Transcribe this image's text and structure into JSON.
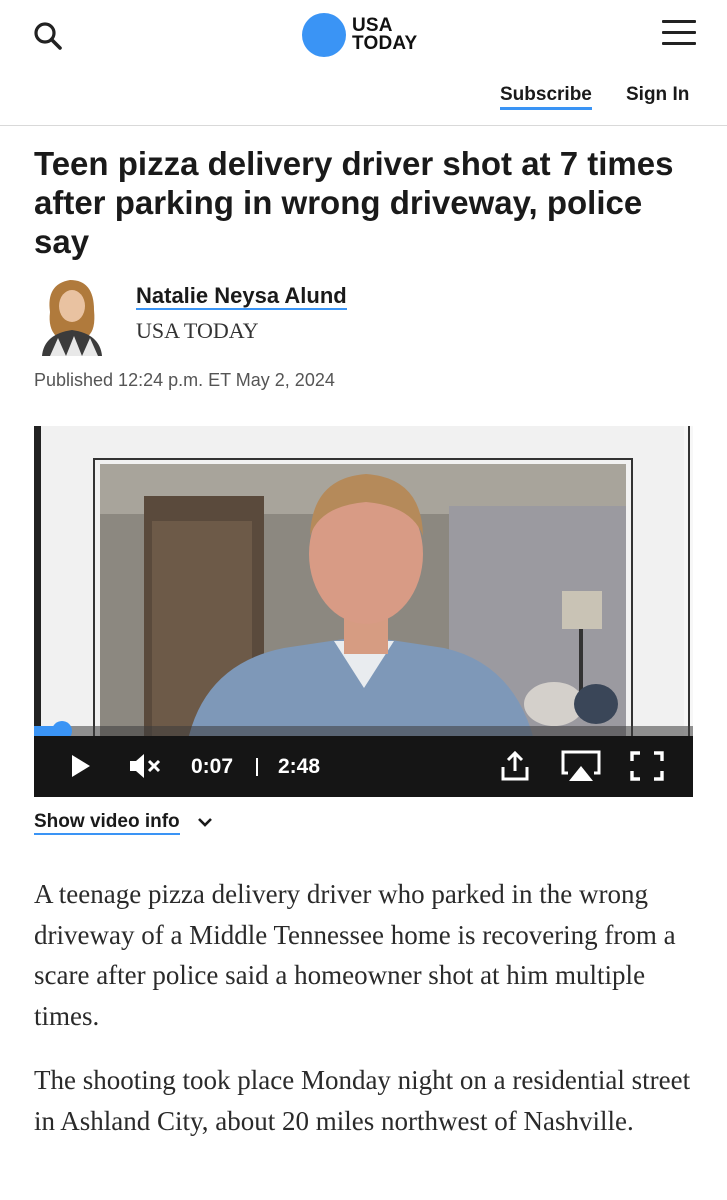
{
  "header": {
    "logo_line1": "USA",
    "logo_line2": "TODAY",
    "subscribe_label": "Subscribe",
    "signin_label": "Sign In",
    "search_icon": "search-icon",
    "menu_icon": "hamburger-menu-icon",
    "brand_color": "#3a94f5"
  },
  "article": {
    "headline": "Teen pizza delivery driver shot at 7 times after parking in wrong driveway, police say",
    "author_name": "Natalie Neysa Alund",
    "author_org": "USA TODAY",
    "published": "Published 12:24 p.m. ET May 2, 2024",
    "paragraphs": [
      "A teenage pizza delivery driver who parked in the wrong driveway of a Middle Tennessee home is recovering from a scare after police said a homeowner shot at him multiple times.",
      "The shooting took place Monday night on a residential street in Ashland City, about 20 miles northwest of Nashville."
    ]
  },
  "video": {
    "current_time": "0:07",
    "duration": "2:48",
    "progress_fraction": 0.042,
    "show_info_label": "Show video info",
    "controls": [
      "play-icon",
      "mute-icon",
      "share-icon",
      "airplay-icon",
      "fullscreen-icon"
    ]
  }
}
